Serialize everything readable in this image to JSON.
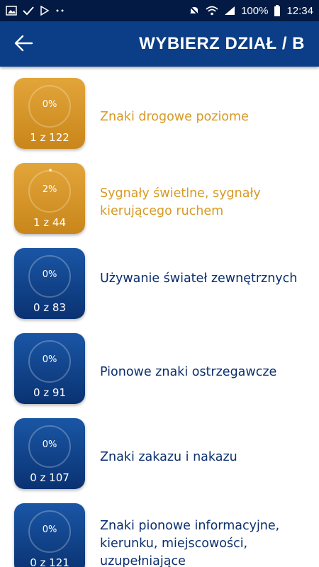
{
  "status_bar": {
    "battery": "100%",
    "time": "12:34",
    "left_icons": [
      "image-icon",
      "check-icon",
      "play-store-icon",
      "more-icon"
    ],
    "right_icons": [
      "mute-icon",
      "wifi-icon",
      "signal-icon",
      "battery-icon"
    ]
  },
  "app_bar": {
    "title": "WYBIERZ DZIAŁ / B",
    "back_icon": "arrow-left-icon",
    "color": "#0b3e86"
  },
  "colors": {
    "orange": "#d79a24",
    "blue": "#0b2f6e"
  },
  "sections": [
    {
      "title": "Znaki drogowe poziome",
      "percent": "0%",
      "count": "1 z 122",
      "color": "orange"
    },
    {
      "title": "Sygnały świetlne, sygnały kierującego ruchem",
      "percent": "2%",
      "count": "1 z 44",
      "color": "orange"
    },
    {
      "title": "Używanie świateł zewnętrznych",
      "percent": "0%",
      "count": "0 z 83",
      "color": "blue"
    },
    {
      "title": "Pionowe znaki ostrzegawcze",
      "percent": "0%",
      "count": "0 z 91",
      "color": "blue"
    },
    {
      "title": "Znaki zakazu i nakazu",
      "percent": "0%",
      "count": "0 z 107",
      "color": "blue"
    },
    {
      "title": "Znaki pionowe informacyjne, kierunku, miejscowości, uzupełniające",
      "percent": "0%",
      "count": "0 z 121",
      "color": "blue"
    }
  ]
}
